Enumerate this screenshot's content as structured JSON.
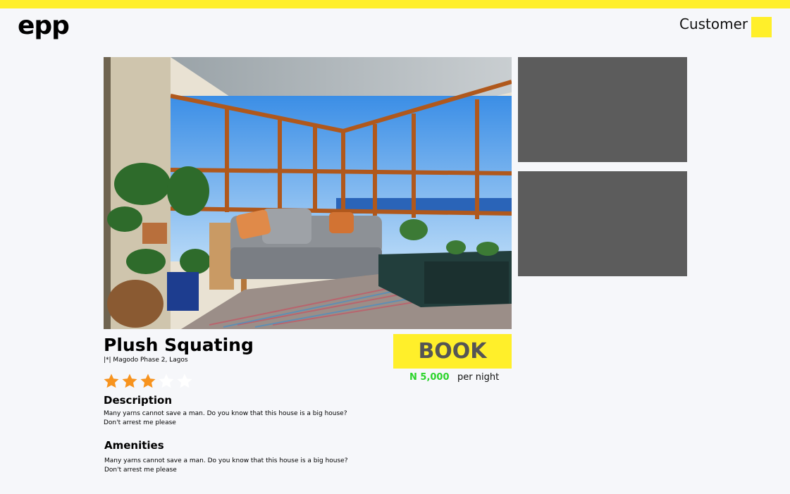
{
  "header": {
    "logo": "epp",
    "user_label": "Customer"
  },
  "listing": {
    "title": "Plush Squating",
    "location": "|*| Magodo Phase 2, Lagos",
    "rating": 3,
    "rating_max": 5,
    "book_label": "BOOK",
    "price": "N 5,000",
    "price_unit": "per night",
    "description_heading": "Description",
    "description_line1": "Many yarns cannot save a man. Do you know that this house is a big house?",
    "description_line2": "Don't arrest me please",
    "amenities_heading": "Amenities",
    "amenities_line1": "Many yarns cannot save a man. Do you know that this house is a big house?",
    "amenities_line2": "Don't arrest me please"
  },
  "colors": {
    "accent": "#ffef2a",
    "price": "#2bd42b",
    "star_filled": "#f7931e",
    "star_empty": "#ffffff",
    "thumbnail": "#5c5c5c"
  }
}
